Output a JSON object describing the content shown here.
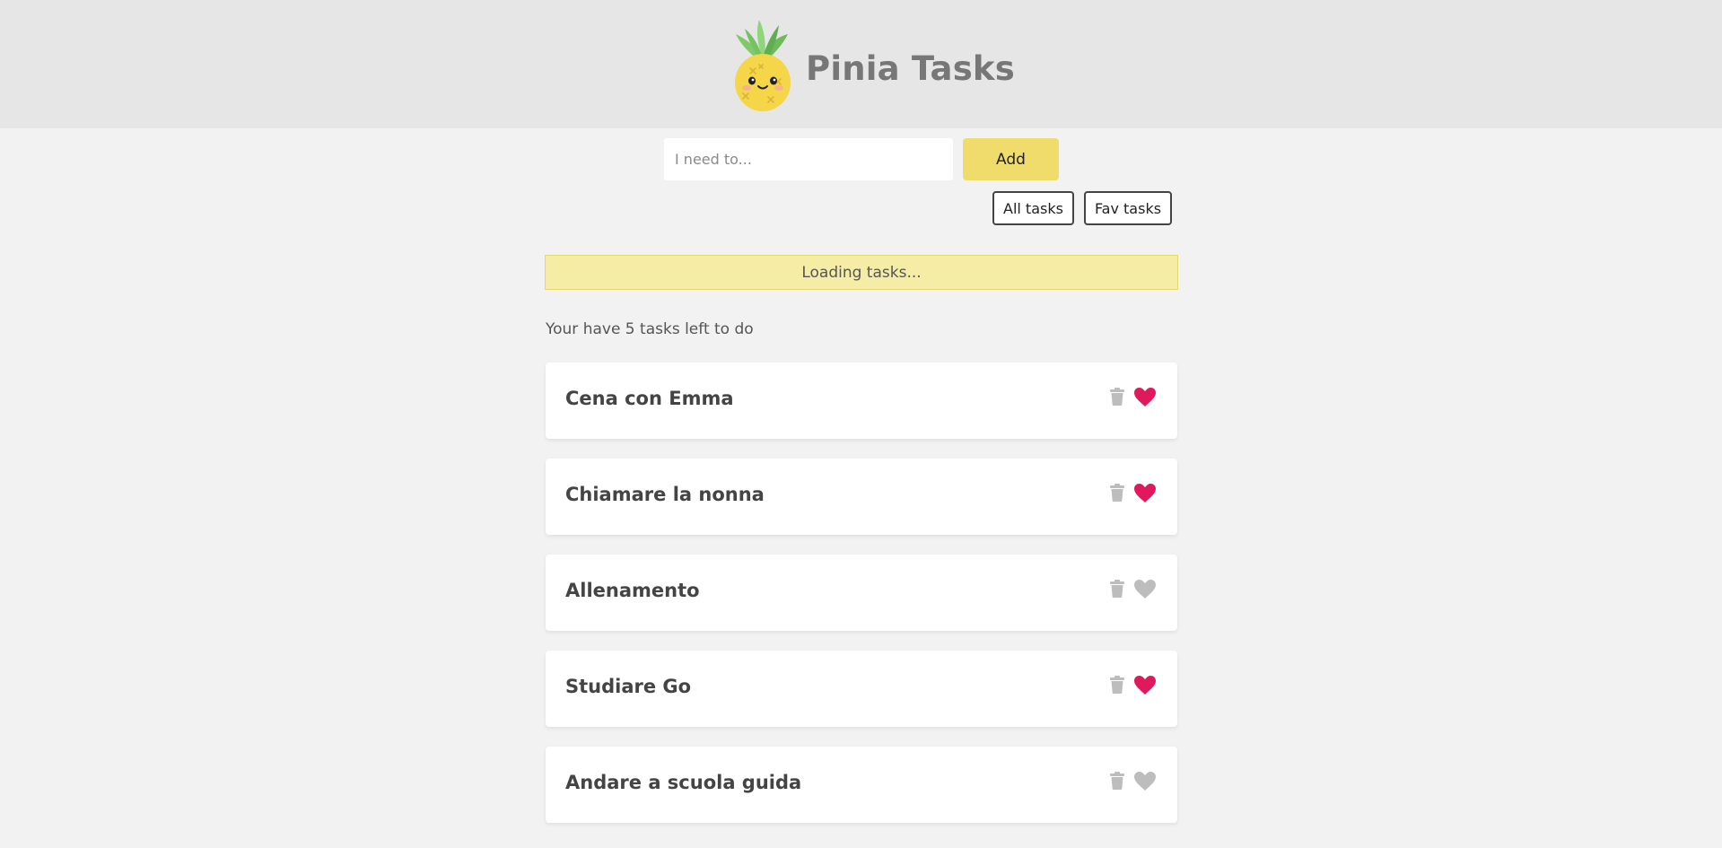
{
  "header": {
    "title": "Pinia Tasks"
  },
  "new_task": {
    "placeholder": "I need to...",
    "value": "",
    "add_label": "Add"
  },
  "filters": {
    "all_label": "All tasks",
    "fav_label": "Fav tasks"
  },
  "status": {
    "loading": "Loading tasks..."
  },
  "summary": {
    "count_text": "Your have 5 tasks left to do"
  },
  "colors": {
    "accent": "#f0dc6a",
    "favorite": "#e0185c",
    "not_favorite": "#bdbdbd",
    "icon_gray": "#bdbdbd"
  },
  "icons": {
    "delete": "trash-icon",
    "favorite": "heart-icon"
  },
  "tasks": [
    {
      "title": "Cena con Emma",
      "favorite": true
    },
    {
      "title": "Chiamare la nonna",
      "favorite": true
    },
    {
      "title": "Allenamento",
      "favorite": false
    },
    {
      "title": "Studiare Go",
      "favorite": true
    },
    {
      "title": "Andare a scuola guida",
      "favorite": false
    }
  ]
}
